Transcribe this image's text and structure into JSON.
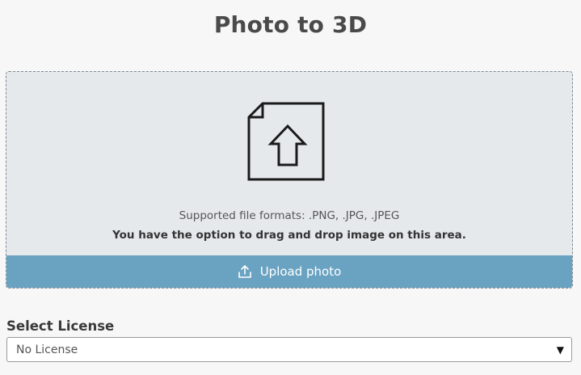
{
  "header": {
    "title": "Photo to 3D"
  },
  "dropzone": {
    "icon": "file-upload-icon",
    "formats_text": "Supported file formats: .PNG, .JPG, .JPEG",
    "drag_hint": "You have the option to drag and drop image on this area.",
    "upload_button": {
      "icon": "upload-icon",
      "label": "Upload photo"
    }
  },
  "license": {
    "label": "Select License",
    "selected": "No License",
    "icon": "chevron-down-icon"
  },
  "colors": {
    "background": "#f7f7f7",
    "dropzone": "#e6e9ec",
    "upload_button": "#6aa3c2"
  }
}
